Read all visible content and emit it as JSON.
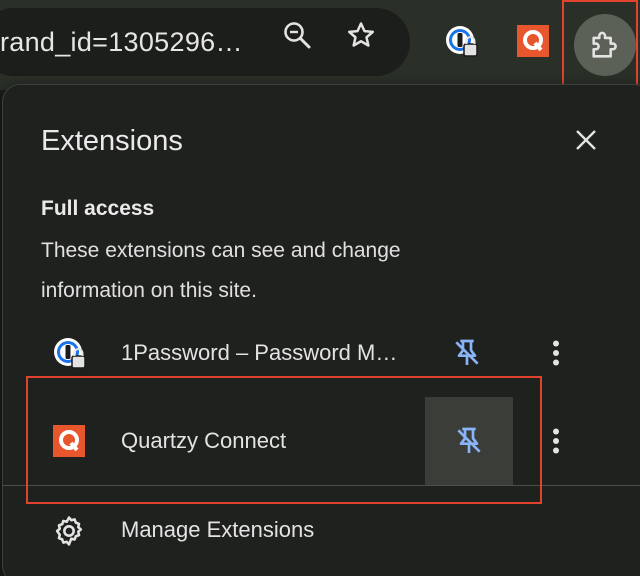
{
  "toolbar": {
    "url_text": "rand_id=1305296…",
    "zoom_icon": "zoom-icon",
    "bookmark_icon": "star-icon",
    "onepassword_icon": "1password-icon",
    "quartzy_icon": "quartzy-icon",
    "extensions_icon": "puzzle-icon"
  },
  "popup": {
    "title": "Extensions",
    "close_icon": "close-icon",
    "section_title": "Full access",
    "section_desc": "These extensions can see and change information on this site.",
    "extensions": [
      {
        "name": "1Password – Password M…",
        "icon": "1password-icon",
        "pinned": false
      },
      {
        "name": "Quartzy Connect",
        "icon": "quartzy-icon",
        "pinned": false
      }
    ],
    "manage_label": "Manage Extensions",
    "manage_icon": "gear-icon"
  },
  "colors": {
    "highlight": "#e0442c",
    "quartzy_orange": "#e8562d",
    "pin_blue": "#8ab4f8",
    "onepassword_blue": "#1a73e8"
  }
}
